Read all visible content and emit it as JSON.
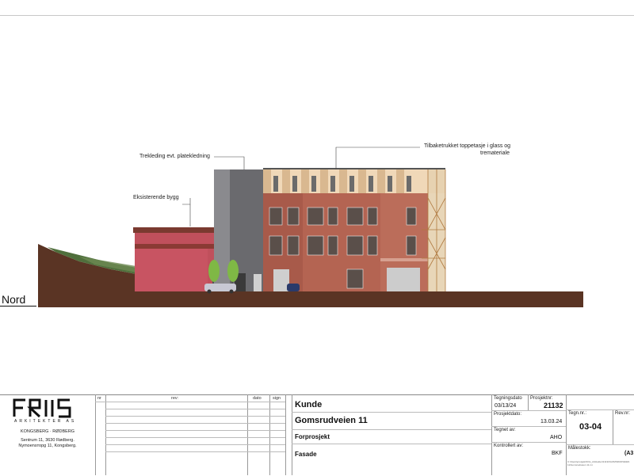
{
  "drawing": {
    "labels": {
      "existing_building": "Eksisterende bygg",
      "cladding": "Trekleding evt. platekledning",
      "top_floor": "Tilbaketrukket toppetasje i glass og trematerial e",
      "top_floor_line1": "Tilbaketrukket toppetasje i glass og",
      "top_floor_line2": "trematerialе"
    },
    "orientation": "Nord"
  },
  "title_block": {
    "logo_text": "FRIIS",
    "logo_sub": "ARKITEKTER AS",
    "office": "KONGSBERG · RØDBERG",
    "address1": "Sentrum 11, 3630 Rødberg.",
    "address2": "Nymoensторg 11, Kongsberg.",
    "rev_headers": {
      "nr": "nr",
      "rev": "rev:",
      "dato": "dato",
      "sign": "sign"
    },
    "client": "Kunde",
    "project_name": "Gomsrudveien 11",
    "phase": "Forprosjekt",
    "drawing_type": "Fasade",
    "labels": {
      "drawing_date": "Tegningsdato",
      "project_no": "Prosjektnr:",
      "project_date": "Prosjektdato:",
      "drawn_by": "Tegnet av:",
      "checked_by": "Kontrollert av:",
      "drawing_no": "Tegn.nr.:",
      "rev_no": "Rev.nr:",
      "scale": "Målestokk:"
    },
    "values": {
      "drawing_date": "03/13/24",
      "project_no": "21132",
      "project_date": "13.03.24",
      "drawn_by": "AHO",
      "checked_by": "BKF",
      "drawing_no": "03-04",
      "scale": "(A3"
    },
    "file_path": "C:\\Users\\prosjekt\\Friis_Arkitekter\\21132\\GOMSRUDVEIEN 11\\Gomsrudveien 11.rvt"
  }
}
